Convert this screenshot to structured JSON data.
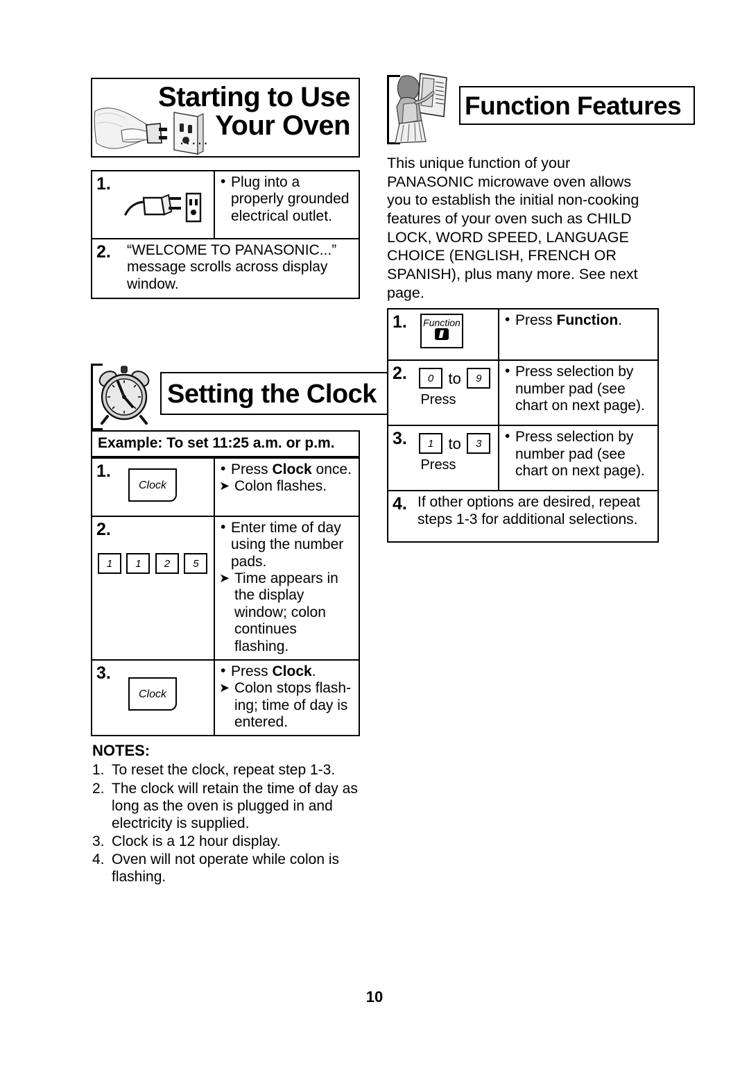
{
  "page": {
    "number": "10"
  },
  "left_column": {
    "banner": {
      "title_line1": "Starting to Use",
      "title_line2": "Your Oven",
      "dots": ".....",
      "art_name": "hand-plug-outlet-illustration"
    },
    "starting_steps": [
      {
        "number": "1.",
        "icon": "plug-and-outlet-icon",
        "bullet": "•",
        "text": "Plug into a properly grounded electrical outlet."
      },
      {
        "number": "2.",
        "text": "“WELCOME TO PANASONIC...” message scrolls across display window."
      }
    ],
    "clock_banner": {
      "title": "Setting the Clock",
      "art_name": "alarm-clock-icon"
    },
    "example_bar": "Example: To set 11:25 a.m. or p.m.",
    "clock_steps": [
      {
        "number": "1.",
        "keys": [
          "Clock"
        ],
        "bullet": "•",
        "line1_pre": "Press ",
        "line1_kw": "Clock",
        "line1_post": " once.",
        "arrow": "➤",
        "line2": "Colon flashes."
      },
      {
        "number": "2.",
        "keys": [
          "1",
          "1",
          "2",
          "5"
        ],
        "bullet": "•",
        "line1": "Enter time of day using the number pads.",
        "arrow": "➤",
        "line2": "Time appears in the display window; colon continues flashing."
      },
      {
        "number": "3.",
        "keys": [
          "Clock"
        ],
        "bullet": "•",
        "line1_pre": "Press ",
        "line1_kw": "Clock",
        "line1_post": ".",
        "arrow": "➤",
        "line2": "Colon stops flash-ing; time of day is entered."
      }
    ],
    "notes": {
      "title": "NOTES:",
      "items": [
        {
          "num": "1.",
          "text": "To reset the clock, repeat step 1-3."
        },
        {
          "num": "2.",
          "text": "The clock will retain the time of day as long as the oven is plugged in and electricity is supplied."
        },
        {
          "num": "3.",
          "text": "Clock is a 12 hour display."
        },
        {
          "num": "4.",
          "text": "Oven will not operate while colon is flashing."
        }
      ]
    }
  },
  "right_column": {
    "banner": {
      "title": "Function Features",
      "art_name": "woman-at-microwave-illustration"
    },
    "intro": "This unique function of your PANASONIC microwave oven allows you to establish the initial non-cooking features of your oven such as CHILD LOCK, WORD SPEED, LANGUAGE CHOICE (ENGLISH, FRENCH OR SPANISH), plus many more. See next page.",
    "function_steps": [
      {
        "number": "1.",
        "key_label": "Function",
        "bullet": "•",
        "text_pre": "Press ",
        "text_kw": "Function",
        "text_post": "."
      },
      {
        "number": "2.",
        "key_from": "0",
        "to_word": "to",
        "key_to": "9",
        "press_word": "Press",
        "bullet": "•",
        "text": "Press selection by number pad (see chart on next page)."
      },
      {
        "number": "3.",
        "key_from": "1",
        "to_word": "to",
        "key_to": "3",
        "press_word": "Press",
        "bullet": "•",
        "text": "Press selection by number pad (see chart on next page)."
      },
      {
        "number": "4.",
        "text": "If other options are desired, repeat steps 1-3 for additional selections."
      }
    ]
  }
}
